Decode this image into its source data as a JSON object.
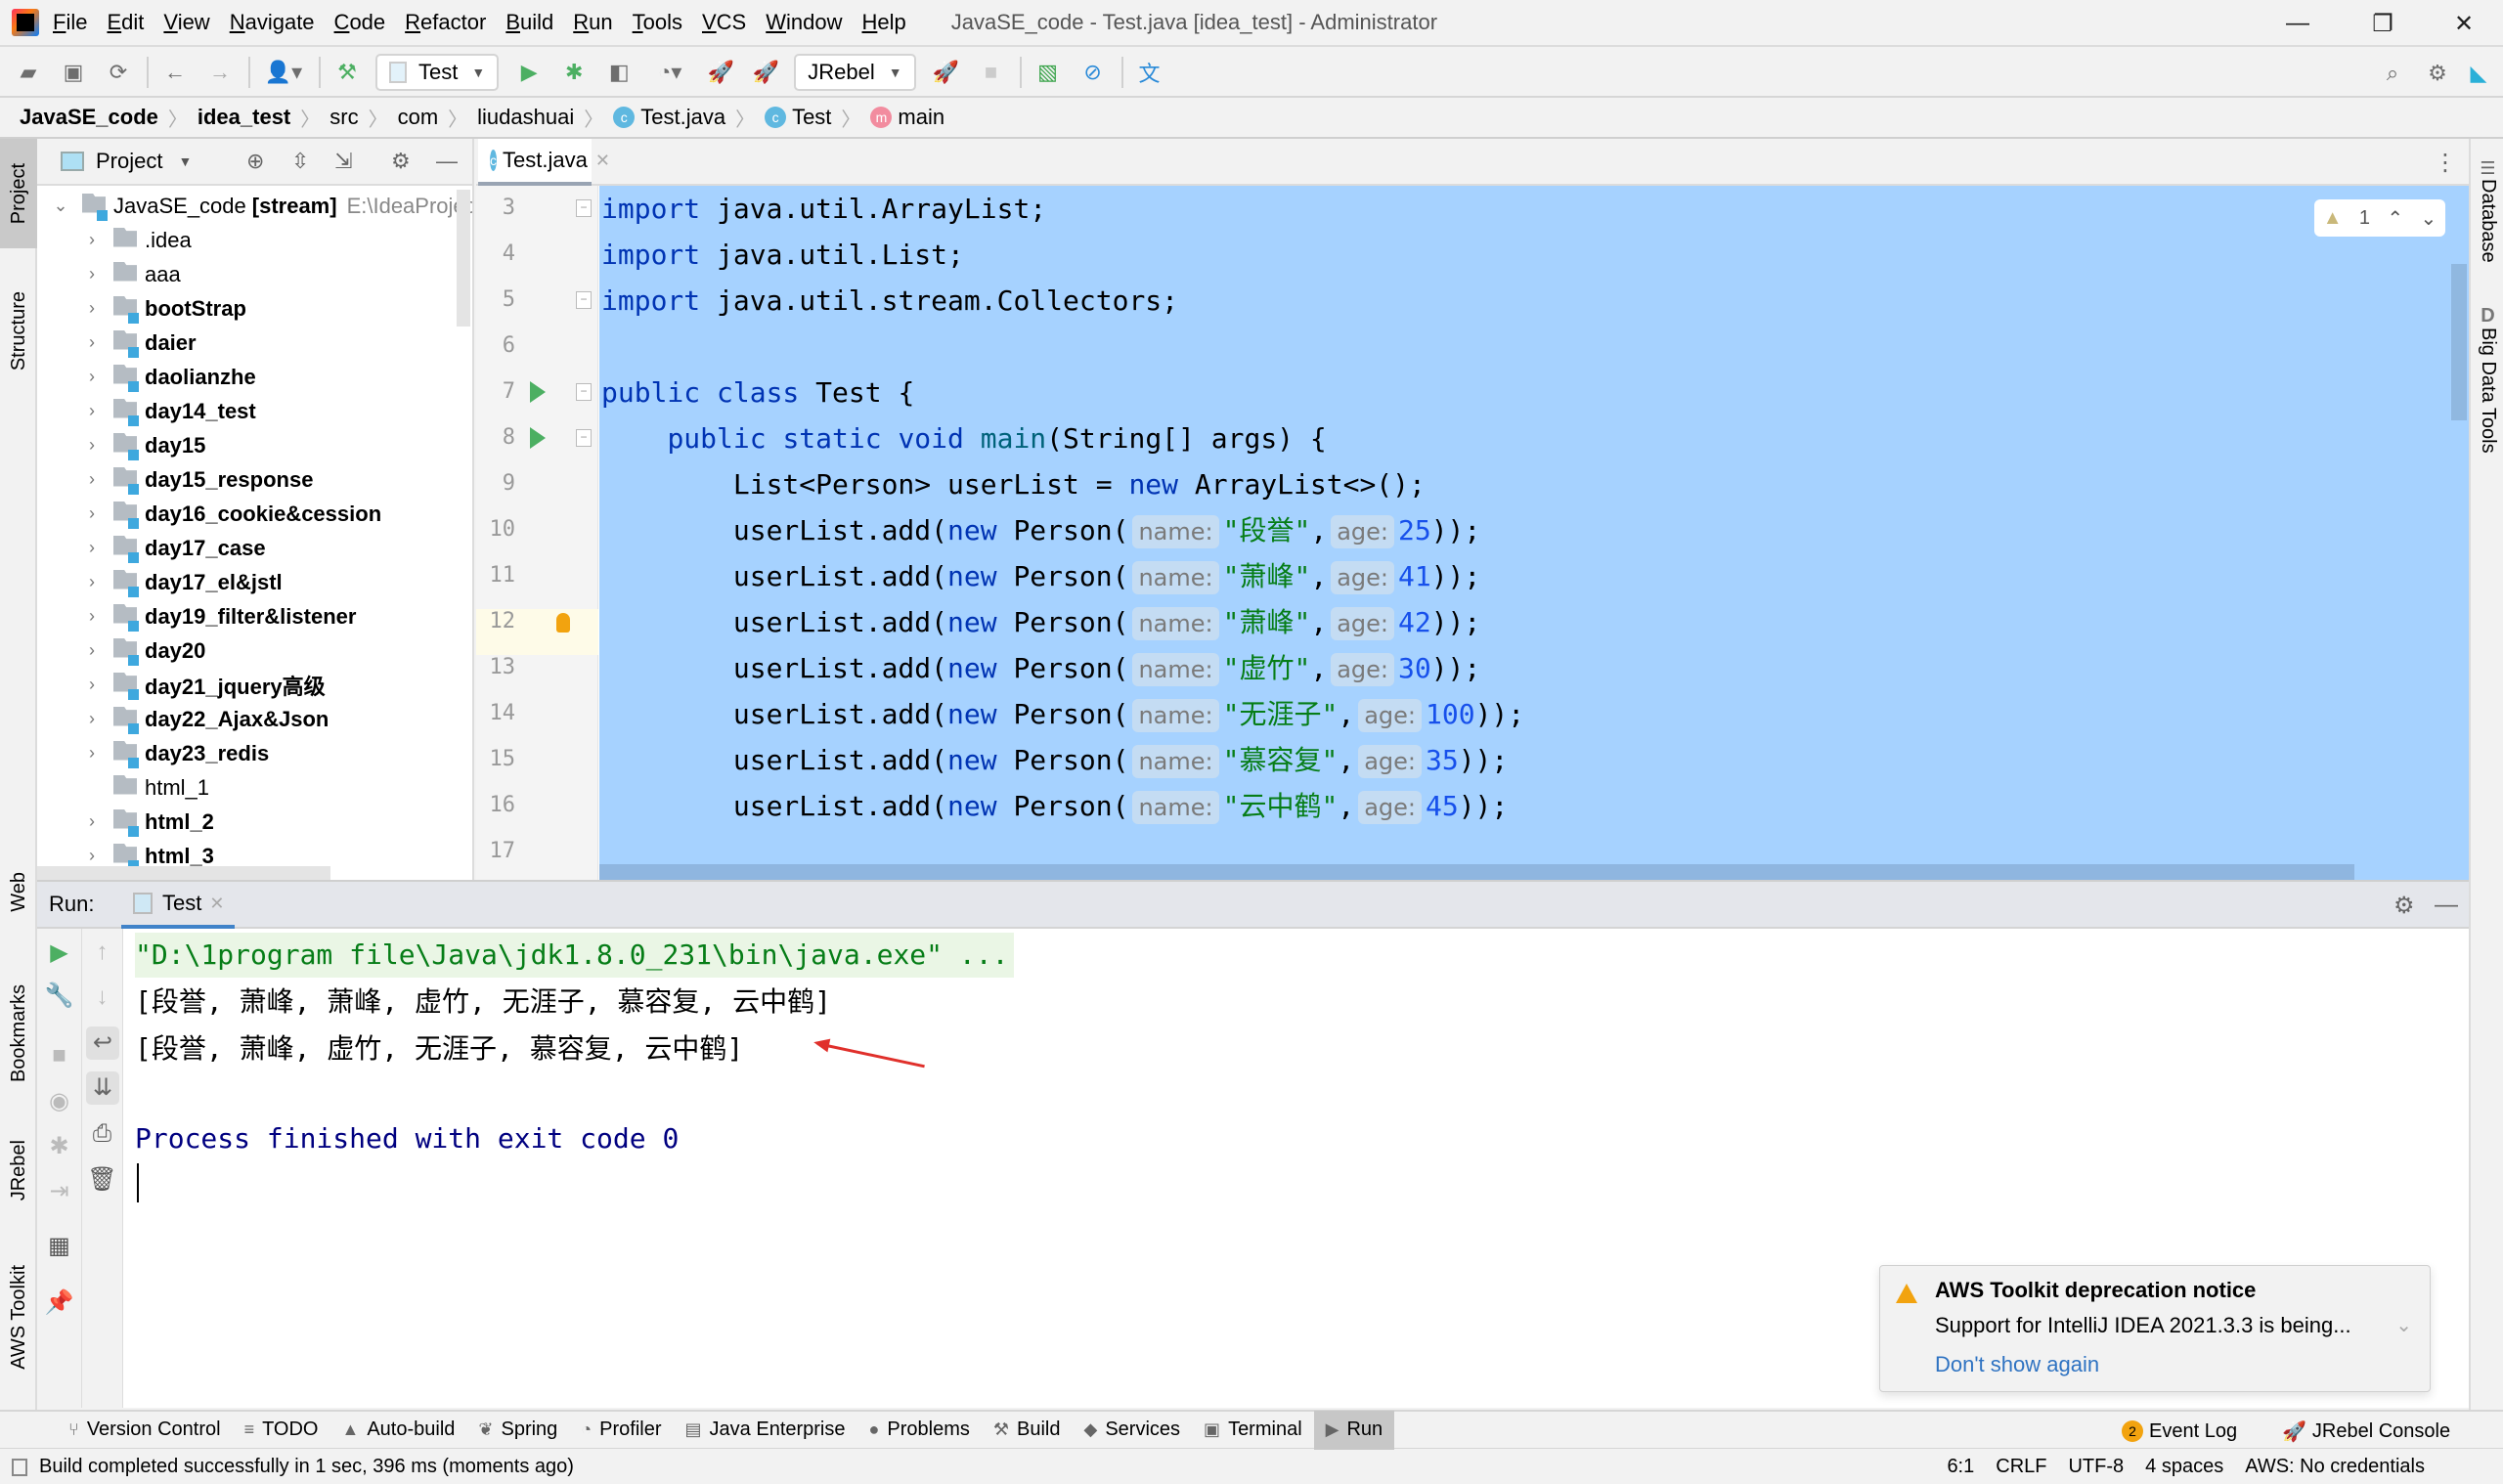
{
  "window": {
    "title": "JavaSE_code - Test.java [idea_test] - Administrator",
    "controls": {
      "minimize": "—",
      "restore": "❐",
      "close": "✕"
    }
  },
  "menu": [
    "File",
    "Edit",
    "View",
    "Navigate",
    "Code",
    "Refactor",
    "Build",
    "Run",
    "Tools",
    "VCS",
    "Window",
    "Help"
  ],
  "toolbar": {
    "run_config": "Test",
    "jrebel_config": "JRebel",
    "icons": [
      "open-folder-icon",
      "save-icon",
      "sync-icon",
      "back-icon",
      "forward-icon",
      "user-icon",
      "build-hammer-icon",
      "run-icon",
      "debug-icon",
      "coverage-icon",
      "profile-icon",
      "jrebel-run-icon",
      "jrebel-debug-icon",
      "jrebel-rocket-icon",
      "stop-icon",
      "monitor-icon",
      "disable-icon",
      "translate-icon",
      "search-icon",
      "settings-icon",
      "plugin-icon"
    ]
  },
  "breadcrumb": [
    {
      "label": "JavaSE_code",
      "bold": true
    },
    {
      "label": "idea_test",
      "bold": true
    },
    {
      "label": "src"
    },
    {
      "label": "com"
    },
    {
      "label": "liudashuai"
    },
    {
      "label": "Test.java",
      "icon": "class"
    },
    {
      "label": "Test",
      "icon": "class"
    },
    {
      "label": "main",
      "icon": "method"
    }
  ],
  "left_strip": {
    "tabs": [
      "Project",
      "Structure",
      "Web",
      "Bookmarks",
      "JRebel",
      "AWS Toolkit"
    ]
  },
  "right_strip": {
    "tabs": [
      "Database",
      "Big Data Tools"
    ]
  },
  "project": {
    "title": "Project",
    "root": {
      "name": "JavaSE_code",
      "tag": "[stream]",
      "path": "E:\\IdeaProject"
    },
    "items": [
      {
        "name": ".idea",
        "module": false,
        "expandable": true
      },
      {
        "name": "aaa",
        "module": false,
        "expandable": true
      },
      {
        "name": "bootStrap",
        "module": true,
        "expandable": true
      },
      {
        "name": "daier",
        "module": true,
        "expandable": true
      },
      {
        "name": "daolianzhe",
        "module": true,
        "expandable": true
      },
      {
        "name": "day14_test",
        "module": true,
        "expandable": true
      },
      {
        "name": "day15",
        "module": true,
        "expandable": true
      },
      {
        "name": "day15_response",
        "module": true,
        "expandable": true
      },
      {
        "name": "day16_cookie&cession",
        "module": true,
        "expandable": true
      },
      {
        "name": "day17_case",
        "module": true,
        "expandable": true
      },
      {
        "name": "day17_el&jstl",
        "module": true,
        "expandable": true
      },
      {
        "name": "day19_filter&listener",
        "module": true,
        "expandable": true
      },
      {
        "name": "day20",
        "module": true,
        "expandable": true
      },
      {
        "name": "day21_jquery高级",
        "module": true,
        "expandable": true
      },
      {
        "name": "day22_Ajax&Json",
        "module": true,
        "expandable": true
      },
      {
        "name": "day23_redis",
        "module": true,
        "expandable": true
      },
      {
        "name": "html_1",
        "module": false,
        "expandable": false
      },
      {
        "name": "html_2",
        "module": true,
        "expandable": true
      },
      {
        "name": "html_3",
        "module": true,
        "expandable": true
      }
    ]
  },
  "editor": {
    "tab": "Test.java",
    "inspection": {
      "warnings": "1"
    },
    "current_line": 12,
    "line_numbers": [
      "3",
      "4",
      "5",
      "6",
      "7",
      "8",
      "9",
      "10",
      "11",
      "12",
      "13",
      "14",
      "15",
      "16",
      "17"
    ],
    "lines": [
      [
        {
          "t": "import",
          "c": "kw"
        },
        {
          "t": " java.util.ArrayList;"
        }
      ],
      [
        {
          "t": "import",
          "c": "kw"
        },
        {
          "t": " java.util.List;"
        }
      ],
      [
        {
          "t": "import",
          "c": "kw"
        },
        {
          "t": " java.util.stream.Collectors;"
        }
      ],
      [],
      [
        {
          "t": "public class",
          "c": "kw"
        },
        {
          "t": " Test {"
        }
      ],
      [
        {
          "t": "    "
        },
        {
          "t": "public static void",
          "c": "kw"
        },
        {
          "t": " "
        },
        {
          "t": "main",
          "c": "fn"
        },
        {
          "t": "(String[] args) {"
        }
      ],
      [
        {
          "t": "        List<Person> userList = "
        },
        {
          "t": "new",
          "c": "kw"
        },
        {
          "t": " ArrayList<>();"
        }
      ],
      [
        {
          "t": "        userList.add("
        },
        {
          "t": "new",
          "c": "kw"
        },
        {
          "t": " Person("
        },
        {
          "t": "name:",
          "c": "hint"
        },
        {
          "t": "\"段誉\"",
          "c": "str"
        },
        {
          "t": ","
        },
        {
          "t": "age:",
          "c": "hint"
        },
        {
          "t": "25",
          "c": "num"
        },
        {
          "t": "));"
        }
      ],
      [
        {
          "t": "        userList.add("
        },
        {
          "t": "new",
          "c": "kw"
        },
        {
          "t": " Person("
        },
        {
          "t": "name:",
          "c": "hint"
        },
        {
          "t": "\"萧峰\"",
          "c": "str"
        },
        {
          "t": ","
        },
        {
          "t": "age:",
          "c": "hint"
        },
        {
          "t": "41",
          "c": "num"
        },
        {
          "t": "));"
        }
      ],
      [
        {
          "t": "        userList.add("
        },
        {
          "t": "new",
          "c": "kw"
        },
        {
          "t": " Person("
        },
        {
          "t": "name:",
          "c": "hint"
        },
        {
          "t": "\"萧峰\"",
          "c": "str"
        },
        {
          "t": ","
        },
        {
          "t": "age:",
          "c": "hint"
        },
        {
          "t": "42",
          "c": "num"
        },
        {
          "t": "));"
        }
      ],
      [
        {
          "t": "        userList.add("
        },
        {
          "t": "new",
          "c": "kw"
        },
        {
          "t": " Person("
        },
        {
          "t": "name:",
          "c": "hint"
        },
        {
          "t": "\"虚竹\"",
          "c": "str"
        },
        {
          "t": ","
        },
        {
          "t": "age:",
          "c": "hint"
        },
        {
          "t": "30",
          "c": "num"
        },
        {
          "t": "));"
        }
      ],
      [
        {
          "t": "        userList.add("
        },
        {
          "t": "new",
          "c": "kw"
        },
        {
          "t": " Person("
        },
        {
          "t": "name:",
          "c": "hint"
        },
        {
          "t": "\"无涯子\"",
          "c": "str"
        },
        {
          "t": ","
        },
        {
          "t": "age:",
          "c": "hint"
        },
        {
          "t": "100",
          "c": "num"
        },
        {
          "t": "));"
        }
      ],
      [
        {
          "t": "        userList.add("
        },
        {
          "t": "new",
          "c": "kw"
        },
        {
          "t": " Person("
        },
        {
          "t": "name:",
          "c": "hint"
        },
        {
          "t": "\"慕容复\"",
          "c": "str"
        },
        {
          "t": ","
        },
        {
          "t": "age:",
          "c": "hint"
        },
        {
          "t": "35",
          "c": "num"
        },
        {
          "t": "));"
        }
      ],
      [
        {
          "t": "        userList.add("
        },
        {
          "t": "new",
          "c": "kw"
        },
        {
          "t": " Person("
        },
        {
          "t": "name:",
          "c": "hint"
        },
        {
          "t": "\"云中鹤\"",
          "c": "str"
        },
        {
          "t": ","
        },
        {
          "t": "age:",
          "c": "hint"
        },
        {
          "t": "45",
          "c": "num"
        },
        {
          "t": "));"
        }
      ],
      []
    ]
  },
  "run": {
    "label": "Run:",
    "tab": "Test",
    "console": {
      "command": "\"D:\\1program file\\Java\\jdk1.8.0_231\\bin\\java.exe\" ...",
      "output1": "[段誉, 萧峰, 萧峰, 虚竹, 无涯子, 慕容复, 云中鹤]",
      "output2": "[段誉, 萧峰, 虚竹, 无涯子, 慕容复, 云中鹤]",
      "exit": "Process finished with exit code 0"
    }
  },
  "notification": {
    "title": "AWS Toolkit deprecation notice",
    "body": "Support for IntelliJ IDEA 2021.3.3 is being...",
    "link": "Don't show again"
  },
  "tool_windows": {
    "left": [
      {
        "label": "Version Control",
        "icon": "version-control-icon",
        "glyph": "⑂"
      },
      {
        "label": "TODO",
        "icon": "todo-icon",
        "glyph": "≡"
      },
      {
        "label": "Auto-build",
        "icon": "auto-build-icon",
        "glyph": "▲"
      },
      {
        "label": "Spring",
        "icon": "spring-icon",
        "glyph": "❦"
      },
      {
        "label": "Profiler",
        "icon": "profiler-icon",
        "glyph": "◔"
      },
      {
        "label": "Java Enterprise",
        "icon": "java-enterprise-icon",
        "glyph": "▤"
      },
      {
        "label": "Problems",
        "icon": "problems-icon",
        "glyph": "●"
      },
      {
        "label": "Build",
        "icon": "build-icon",
        "glyph": "⚒"
      },
      {
        "label": "Services",
        "icon": "services-icon",
        "glyph": "◆"
      },
      {
        "label": "Terminal",
        "icon": "terminal-icon",
        "glyph": "▣"
      },
      {
        "label": "Run",
        "icon": "run-icon",
        "glyph": "▶",
        "active": true
      }
    ],
    "event_log": {
      "label": "Event Log",
      "count": "2"
    },
    "jrebel_console": "JRebel Console"
  },
  "status": {
    "message": "Build completed successfully in 1 sec, 396 ms (moments ago)",
    "position": "6:1",
    "line_sep": "CRLF",
    "encoding": "UTF-8",
    "indent": "4 spaces",
    "aws": "AWS: No credentials"
  }
}
